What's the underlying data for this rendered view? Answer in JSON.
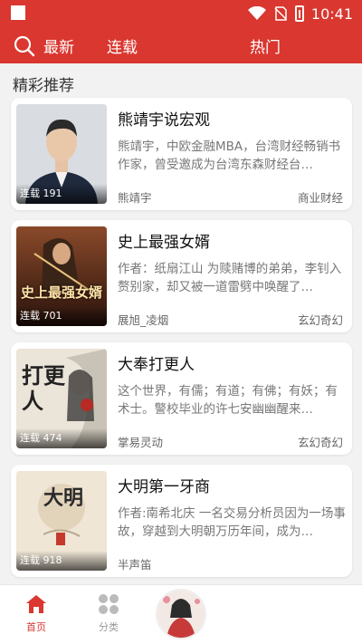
{
  "status_bar": {
    "time": "10:41"
  },
  "top_nav": {
    "tabs": [
      {
        "label": "最新"
      },
      {
        "label": "连载"
      },
      {
        "label": "热门"
      }
    ]
  },
  "section": {
    "title": "精彩推荐"
  },
  "books": [
    {
      "title": "熊靖宇说宏观",
      "desc": "熊靖宇，中欧金融MBA，台湾财经畅销书作家，曾受邀成为台湾东森财经台…",
      "author": "熊靖宇",
      "category": "商业财经",
      "badge": "连载 191"
    },
    {
      "title": "史上最强女婿",
      "desc": "作者：纸扇江山 为赎赌博的弟弟，李钊入赘别家，却又被一道雷劈中唤醒了…",
      "author": "展旭_凌烟",
      "category": "玄幻奇幻",
      "badge": "连载 701",
      "cover_text": "史上最强女婿"
    },
    {
      "title": "大奉打更人",
      "desc": "这个世界，有儒；有道；有佛；有妖；有术士。警校毕业的许七安幽幽醒来…",
      "author": "掌易灵动",
      "category": "玄幻奇幻",
      "badge": "连载 474",
      "cover_text": "打更人"
    },
    {
      "title": "大明第一牙商",
      "desc": "作者:南希北庆 一名交易分析员因为一场事故，穿越到大明朝万历年间，成为…",
      "author": "半声笛",
      "category": "",
      "badge": "连载 918",
      "cover_text": "大明"
    }
  ],
  "bottom_nav": {
    "home_label": "首页",
    "category_label": "分类"
  },
  "colors": {
    "accent": "#d9372f"
  }
}
